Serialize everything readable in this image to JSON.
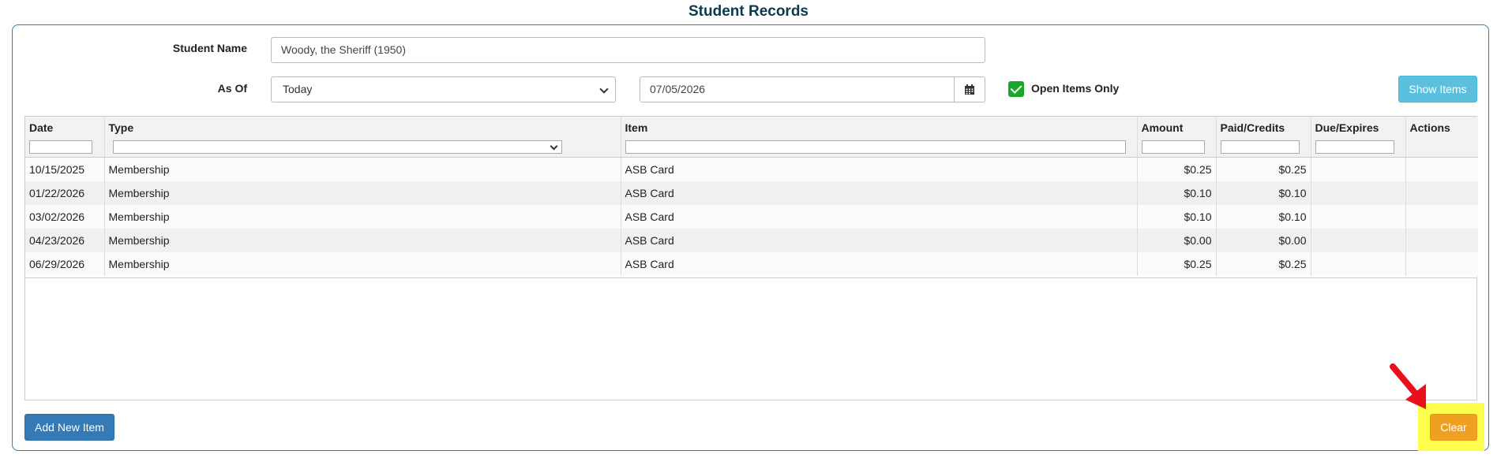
{
  "page": {
    "title": "Student Records"
  },
  "form": {
    "student_label": "Student Name",
    "student_value": "Woody, the Sheriff (1950)",
    "asof_label": "As Of",
    "asof_selected": "Today",
    "date_value": "07/05/2026",
    "open_only_label": "Open Items Only",
    "open_only_checked": true,
    "show_button": "Show Items"
  },
  "table": {
    "columns": [
      "Date",
      "Type",
      "Item",
      "Amount",
      "Paid/Credits",
      "Due/Expires",
      "Actions"
    ],
    "rows": [
      {
        "date": "10/15/2025",
        "type": "Membership",
        "item": "ASB Card",
        "amount": "$0.25",
        "paid": "$0.25",
        "due": "",
        "actions": ""
      },
      {
        "date": "01/22/2026",
        "type": "Membership",
        "item": "ASB Card",
        "amount": "$0.10",
        "paid": "$0.10",
        "due": "",
        "actions": ""
      },
      {
        "date": "03/02/2026",
        "type": "Membership",
        "item": "ASB Card",
        "amount": "$0.10",
        "paid": "$0.10",
        "due": "",
        "actions": ""
      },
      {
        "date": "04/23/2026",
        "type": "Membership",
        "item": "ASB Card",
        "amount": "$0.00",
        "paid": "$0.00",
        "due": "",
        "actions": ""
      },
      {
        "date": "06/29/2026",
        "type": "Membership",
        "item": "ASB Card",
        "amount": "$0.25",
        "paid": "$0.25",
        "due": "",
        "actions": ""
      }
    ]
  },
  "footer": {
    "add_button": "Add New Item",
    "clear_button": "Clear"
  },
  "icons": {
    "calendar": "calendar-icon",
    "checkmark": "check-icon",
    "annotation": "red-arrow-icon"
  },
  "colors": {
    "title": "#0b3a4d",
    "panel_border": "#3a7ca5",
    "show_button": "#5bc0de",
    "add_button": "#337ab7",
    "clear_button": "#f0a020",
    "highlight": "#ffff4d",
    "checkbox": "#1aa62c",
    "annotation_arrow": "#e8101a"
  }
}
